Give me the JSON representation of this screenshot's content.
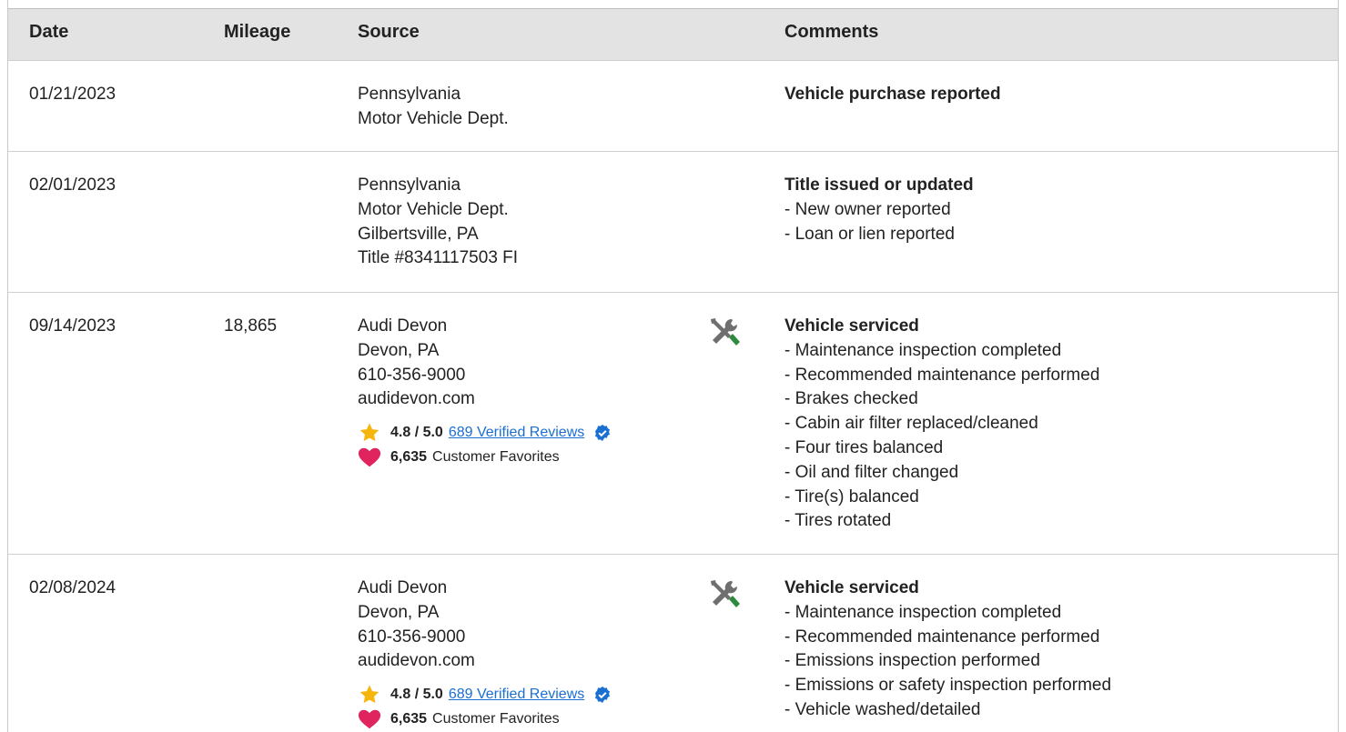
{
  "columns": {
    "date": "Date",
    "mileage": "Mileage",
    "source": "Source",
    "comments": "Comments"
  },
  "rows": [
    {
      "date": "01/21/2023",
      "mileage": "",
      "source": [
        "Pennsylvania",
        "Motor Vehicle Dept."
      ],
      "comment_title": "Vehicle purchase reported",
      "comment_items": []
    },
    {
      "date": "02/01/2023",
      "mileage": "",
      "source": [
        "Pennsylvania",
        "Motor Vehicle Dept.",
        "Gilbertsville, PA",
        "Title #8341117503 FI"
      ],
      "comment_title": "Title issued or updated",
      "comment_items": [
        "- New owner reported",
        "- Loan or lien reported"
      ]
    },
    {
      "date": "09/14/2023",
      "mileage": "18,865",
      "source": [
        "Audi Devon",
        "Devon, PA",
        "610-356-9000",
        "audidevon.com"
      ],
      "rating": "4.8 / 5.0",
      "reviews_link": "689 Verified Reviews",
      "favorites_count": "6,635",
      "favorites_label": "Customer Favorites",
      "icon": "service-tools-icon",
      "comment_title": "Vehicle serviced",
      "comment_items": [
        "- Maintenance inspection completed",
        "- Recommended maintenance performed",
        "- Brakes checked",
        "- Cabin air filter replaced/cleaned",
        "- Four tires balanced",
        "- Oil and filter changed",
        "- Tire(s) balanced",
        "- Tires rotated"
      ]
    },
    {
      "date": "02/08/2024",
      "mileage": "",
      "source": [
        "Audi Devon",
        "Devon, PA",
        "610-356-9000",
        "audidevon.com"
      ],
      "rating": "4.8 / 5.0",
      "reviews_link": "689 Verified Reviews",
      "favorites_count": "6,635",
      "favorites_label": "Customer Favorites",
      "icon": "service-tools-icon",
      "comment_title": "Vehicle serviced",
      "comment_items": [
        "- Maintenance inspection completed",
        "- Recommended maintenance performed",
        "- Emissions inspection performed",
        "- Emissions or safety inspection performed",
        "- Vehicle washed/detailed"
      ]
    }
  ],
  "colors": {
    "header_bg": "#e3e3e3",
    "link": "#1a6fd1",
    "star": "#f5b50a",
    "heart": "#e0245e",
    "verified_badge": "#1a6fd1",
    "wrench_green": "#2e8b3e"
  }
}
